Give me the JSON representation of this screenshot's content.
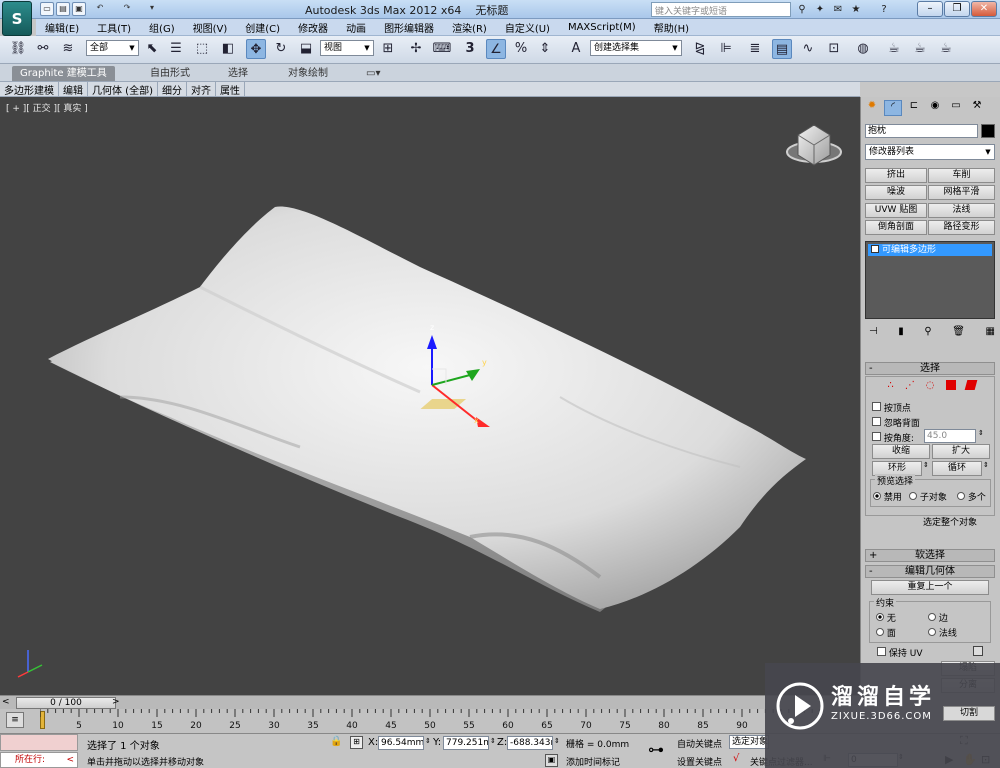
{
  "titlebar": {
    "logo": "S",
    "app_title": "Autodesk 3ds Max  2012 x64",
    "file_name": "无标题",
    "search_placeholder": "键入关键字或短语"
  },
  "menubar": [
    "编辑(E)",
    "工具(T)",
    "组(G)",
    "视图(V)",
    "创建(C)",
    "修改器",
    "动画",
    "图形编辑器",
    "渲染(R)",
    "自定义(U)",
    "MAXScript(M)",
    "帮助(H)"
  ],
  "toolbar": {
    "selection_filter": "全部",
    "reference_coord": "视图",
    "named_selection": "创建选择集",
    "snap_label": "3",
    "percent_snap": "%",
    "angle_label": "A"
  },
  "ribbon": {
    "tabs": [
      "Graphite 建模工具",
      "自由形式",
      "选择",
      "对象绘制"
    ],
    "subtabs": [
      "多边形建模",
      "编辑",
      "几何体 (全部)",
      "细分",
      "对齐",
      "属性"
    ]
  },
  "viewport": {
    "label": "[ + ][ 正交 ][ 真实 ]",
    "axis_x": "x",
    "axis_y": "y",
    "axis_z": "z"
  },
  "command_panel": {
    "object_name": "抱枕",
    "modifier_list": "修改器列表",
    "modifier_buttons": [
      "挤出",
      "车削",
      "噪波",
      "网格平滑",
      "UVW 贴图",
      "法线",
      "倒角剖面",
      "路径变形"
    ],
    "stack_item": "可编辑多边形",
    "selection_rollout": {
      "title": "选择",
      "by_vertex": "按顶点",
      "ignore_backfacing": "忽略背面",
      "by_angle": "按角度:",
      "angle_value": "45.0",
      "shrink": "收缩",
      "grow": "扩大",
      "ring": "环形",
      "loop": "循环",
      "preview_title": "预览选择",
      "preview_disabled": "禁用",
      "preview_subobject": "子对象",
      "preview_multi": "多个",
      "status": "选定整个对象"
    },
    "soft_selection": "软选择",
    "edit_geometry": "编辑几何体",
    "repeat_last": "重复上一个",
    "constraints_title": "约束",
    "constraint_none": "无",
    "constraint_edge": "边",
    "constraint_face": "面",
    "constraint_normal": "法线",
    "preserve_uv": "保持 UV",
    "collapse": "塌陷",
    "detach": "分离",
    "slice": "切割"
  },
  "timeline": {
    "frame_display": "0 / 100",
    "ticks": [
      "5",
      "10",
      "15",
      "20",
      "25",
      "30",
      "35",
      "40",
      "45",
      "50",
      "55",
      "60",
      "65",
      "70",
      "75",
      "80",
      "85",
      "90"
    ]
  },
  "status": {
    "maxscript_label": "所在行:",
    "message1": "选择了 1 个对象",
    "message2": "单击并拖动以选择并移动对象",
    "x_label": "X:",
    "x_value": "96.54mm",
    "y_label": "Y:",
    "y_value": "779.251mr",
    "z_label": "Z:",
    "z_value": "-688.343m",
    "grid": "栅格 = 0.0mm",
    "add_time_tag": "添加时间标记",
    "auto_key": "自动关键点",
    "set_key": "设置关键点",
    "selected_object": "选定对象",
    "key_filters": "关键点过滤器...",
    "current_frame": "0"
  },
  "watermark": {
    "brand": "溜溜自学",
    "url": "ZIXUE.3D66.COM"
  },
  "colors": {
    "viewport_bg": "#434343",
    "title_bar": "#b6d0ee",
    "stack_highlight": "#3399ff",
    "red_selection": "#ff0000"
  }
}
